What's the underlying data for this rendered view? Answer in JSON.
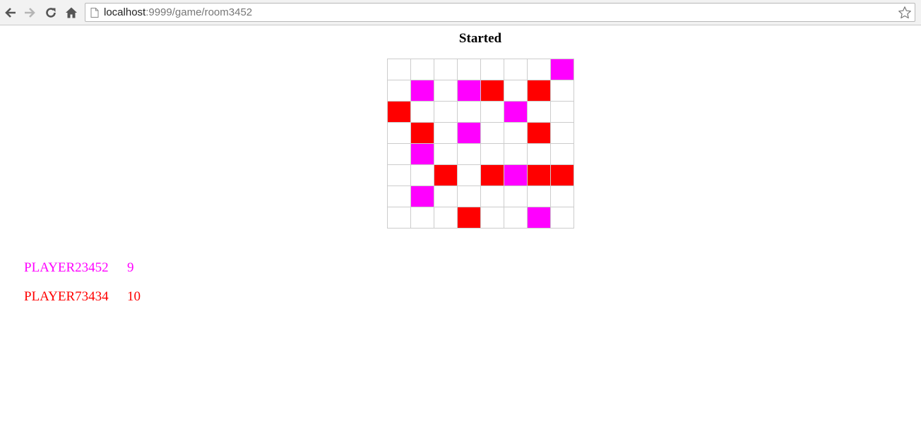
{
  "browser": {
    "url_host": "localhost",
    "url_path": ":9999/game/room3452"
  },
  "game": {
    "status": "Started",
    "colors": {
      "empty": "#ffffff",
      "magenta": "#ff00ff",
      "red": "#ff0000"
    },
    "board": [
      [
        "empty",
        "empty",
        "empty",
        "empty",
        "empty",
        "empty",
        "empty",
        "magenta"
      ],
      [
        "empty",
        "magenta",
        "empty",
        "magenta",
        "red",
        "empty",
        "red",
        "empty"
      ],
      [
        "red",
        "empty",
        "empty",
        "empty",
        "empty",
        "magenta",
        "empty",
        "empty"
      ],
      [
        "empty",
        "red",
        "empty",
        "magenta",
        "empty",
        "empty",
        "red",
        "empty"
      ],
      [
        "empty",
        "magenta",
        "empty",
        "empty",
        "empty",
        "empty",
        "empty",
        "empty"
      ],
      [
        "empty",
        "empty",
        "red",
        "empty",
        "red",
        "magenta",
        "red",
        "red"
      ],
      [
        "empty",
        "magenta",
        "empty",
        "empty",
        "empty",
        "empty",
        "empty",
        "empty"
      ],
      [
        "empty",
        "empty",
        "empty",
        "red",
        "empty",
        "empty",
        "magenta",
        "empty"
      ]
    ],
    "players": [
      {
        "name": "PLAYER23452",
        "score": "9",
        "color": "#ff00ff"
      },
      {
        "name": "PLAYER73434",
        "score": "10",
        "color": "#ff0000"
      }
    ]
  }
}
